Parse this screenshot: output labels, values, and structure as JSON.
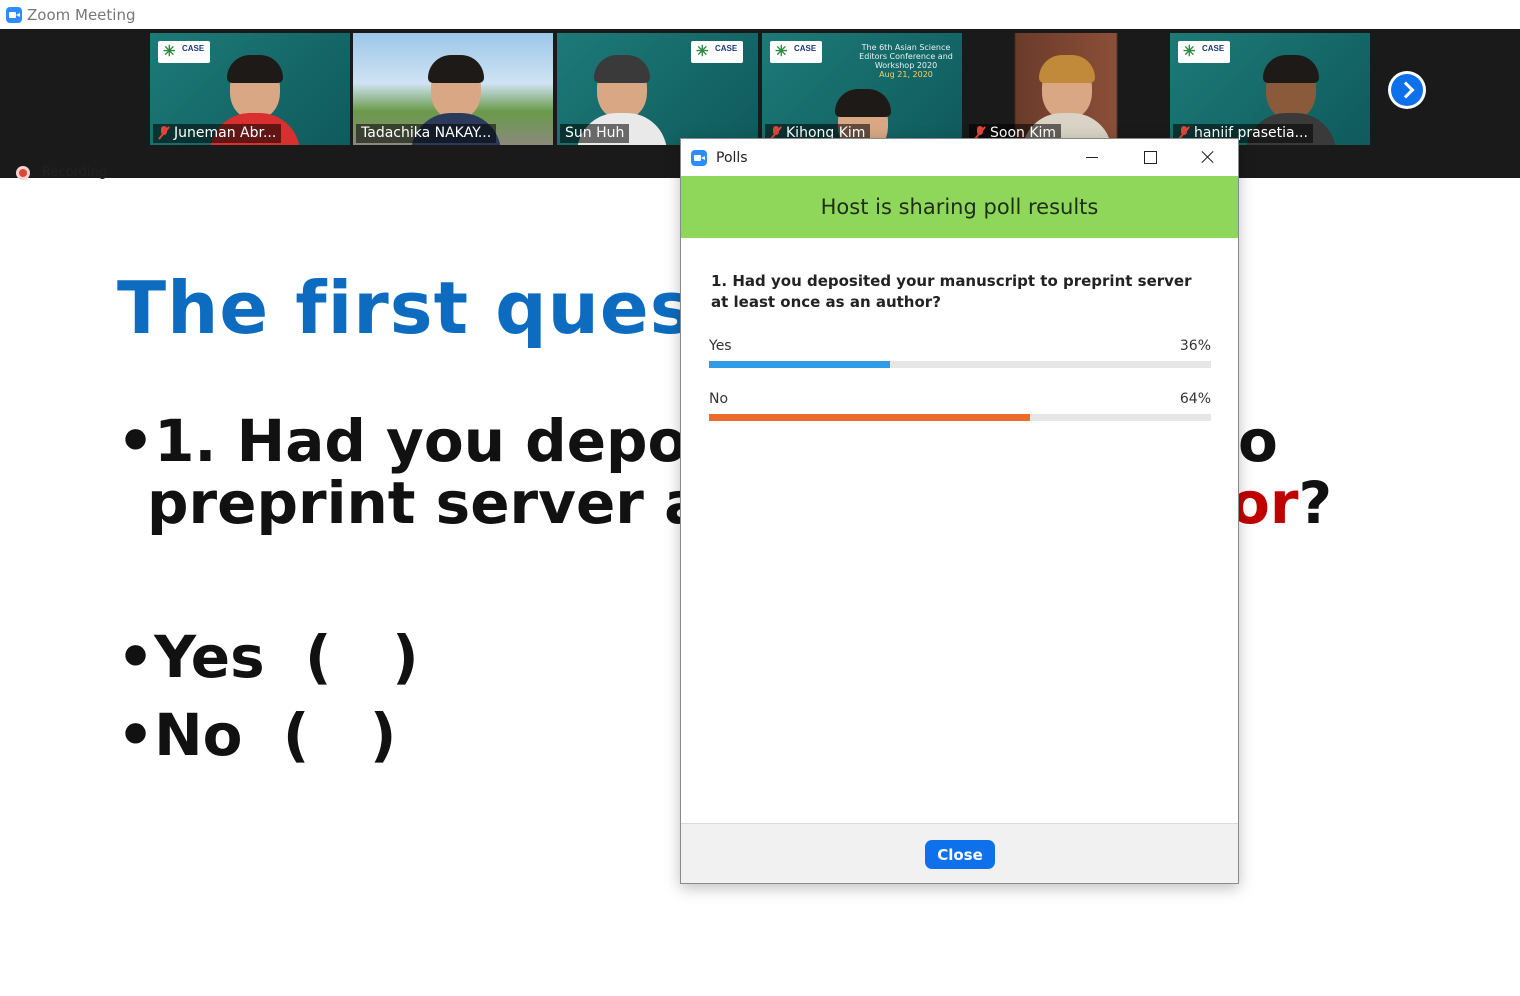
{
  "window": {
    "title": "Zoom Meeting"
  },
  "participants": [
    {
      "name": "Juneman Abr...",
      "muted": true
    },
    {
      "name": "Tadachika NAKAY...",
      "muted": false
    },
    {
      "name": "Sun Huh",
      "muted": false,
      "active": true
    },
    {
      "name": "Kihong Kim",
      "muted": true
    },
    {
      "name": "Soon Kim",
      "muted": true
    },
    {
      "name": "haniif prasetia...",
      "muted": true
    }
  ],
  "recording": {
    "label": "Recording"
  },
  "slide": {
    "title": "The first questior",
    "q_line1": "•1. Had you deposite",
    "q_line1_tail": "o",
    "q_line2": "preprint server at le",
    "q_line2_tail_red": "or",
    "q_line2_tail_black": "?",
    "yes": "•Yes  (   )",
    "no": "•No  (   )"
  },
  "polls": {
    "title": "Polls",
    "banner": "Host is sharing poll results",
    "question": "1. Had you deposited your manuscript to preprint server at least once as an author?",
    "options": [
      {
        "label": "Yes",
        "percent_text": "36%",
        "value": 36,
        "color": "#2f9ce8"
      },
      {
        "label": "No",
        "percent_text": "64%",
        "value": 64,
        "color": "#ec6a2c"
      }
    ],
    "close_label": "Close"
  },
  "colors": {
    "zoom_blue": "#0e71eb",
    "banner_green": "#8fd75a",
    "slide_title_blue": "#0d6cc0"
  }
}
